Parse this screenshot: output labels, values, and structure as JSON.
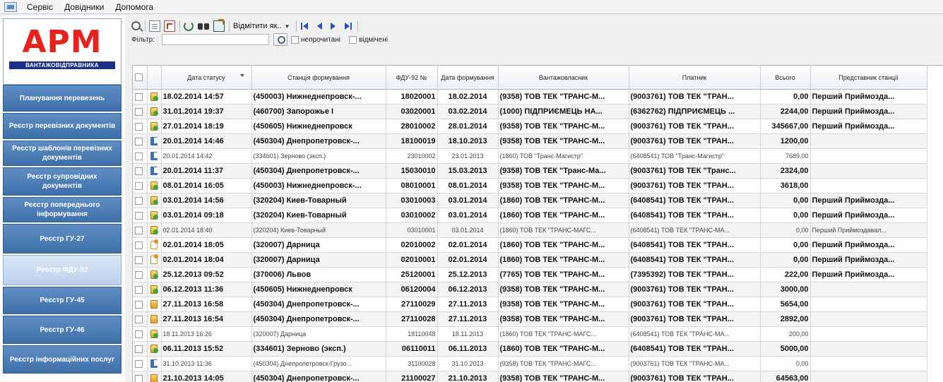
{
  "menu": {
    "items": [
      "Сервіс",
      "Довідники",
      "Допомога"
    ]
  },
  "logo": {
    "main": "АРМ",
    "sub": "ВАНТАЖОВІДПРАВНИКА"
  },
  "sidebar": {
    "items": [
      {
        "label": "Планування перевезень",
        "active": false
      },
      {
        "label": "Реєстр перевізних документів",
        "active": false
      },
      {
        "label": "Реєстр шаблонів перевізних документів",
        "active": false
      },
      {
        "label": "Реєстр супровідних документів",
        "active": false
      },
      {
        "label": "Реєстр попереднього інформування",
        "active": false
      },
      {
        "label": "Реєстр ГУ-27",
        "active": false
      },
      {
        "label": "Реєстр ФДУ-92",
        "active": true
      },
      {
        "label": "Реєстр ГУ-45",
        "active": false
      },
      {
        "label": "Реєстр ГУ-46",
        "active": false
      },
      {
        "label": "Реєстр інформаційних послуг",
        "active": false
      }
    ]
  },
  "toolbar": {
    "mark_label": "Відмітити як..",
    "icons": [
      "preview-icon",
      "document-icon",
      "pdf-icon",
      "refresh-icon",
      "binoculars-icon",
      "export-icon"
    ],
    "nav_icons": [
      "first-record-icon",
      "previous-record-icon",
      "next-record-icon",
      "last-record-icon"
    ]
  },
  "filter": {
    "label": "Фільтр:",
    "value": "",
    "checkbox_unread": "непрочитані",
    "checkbox_marked": "відмічені"
  },
  "grid": {
    "columns": [
      "Дата статусу",
      "Станція формування",
      "ФДУ-92 №",
      "Дата формування",
      "Вантажовласник",
      "Платник",
      "Всього",
      "Представник станції"
    ],
    "rows": [
      {
        "style": "bold",
        "icon": "green-status-icon",
        "date_status": "18.02.2014 14:57",
        "station": "(450003) Нижнеднепровск-...",
        "num": "18020001",
        "date_form": "18.02.2014",
        "owner": "(9358) ТОВ ТЕК \"ТРАНС-М...",
        "payer": "(9003761) ТОВ ТЕК \"ТРАН...",
        "total": "0,00",
        "rep": "Перший Приймоздa..."
      },
      {
        "style": "bold",
        "icon": "green-status-icon",
        "date_status": "31.01.2014 19:37",
        "station": "(460700) Запорожье I",
        "num": "03020001",
        "date_form": "03.02.2014",
        "owner": "(1000) ПІДПРИЄМЕЦЬ НА...",
        "payer": "(6362762) ПІДПРИЄМЕЦЬ ...",
        "total": "2244,00",
        "rep": "Перший Приймоздa..."
      },
      {
        "style": "bold",
        "icon": "green-status-icon",
        "date_status": "27.01.2014 18:19",
        "station": "(450605) Нижнеднепровск",
        "num": "28010002",
        "date_form": "28.01.2014",
        "owner": "(9358) ТОВ ТЕК \"ТРАНС-М...",
        "payer": "(9003761) ТОВ ТЕК \"ТРАН...",
        "total": "345667,00",
        "rep": "Перший Приймоздa..."
      },
      {
        "style": "bold",
        "icon": "blue-status-icon",
        "date_status": "20.01.2014 14:46",
        "station": "(450304) Днепропетровск-...",
        "num": "18100019",
        "date_form": "18.10.2013",
        "owner": "(9358) ТОВ ТЕК \"ТРАНС-М...",
        "payer": "(9003761) ТОВ ТЕК \"ТРАН...",
        "total": "1200,00",
        "rep": ""
      },
      {
        "style": "light",
        "icon": "blue-status-icon",
        "date_status": "20.01.2014 14:42",
        "station": "(334601) Зерново (эксп.)",
        "num": "23010002",
        "date_form": "23.01.2013",
        "owner": "(1860) ТОВ \"Транс-Магистр\"",
        "payer": "(6408541) ТОВ \"Транс-Магистр\"",
        "total": "7689,00",
        "rep": ""
      },
      {
        "style": "bold",
        "icon": "blue-status-icon",
        "date_status": "20.01.2014 11:37",
        "station": "(450304) Днепропетровск-...",
        "num": "15030010",
        "date_form": "15.03.2013",
        "owner": "(9358) ТОВ ТЕК \"Транс-Ма...",
        "payer": "(9003761) ТОВ ТЕК \"Транс...",
        "total": "2324,00",
        "rep": ""
      },
      {
        "style": "bold",
        "icon": "green-status-icon",
        "date_status": "08.01.2014 16:05",
        "station": "(450003) Нижнеднепровск-...",
        "num": "08010001",
        "date_form": "08.01.2014",
        "owner": "(9358) ТОВ ТЕК \"ТРАНС-М...",
        "payer": "(9003761) ТОВ ТЕК \"ТРАН...",
        "total": "3618,00",
        "rep": ""
      },
      {
        "style": "bold",
        "icon": "green-status-icon",
        "date_status": "03.01.2014 14:56",
        "station": "(320204) Киев-Товарный",
        "num": "03010003",
        "date_form": "03.01.2014",
        "owner": "(1860) ТОВ ТЕК \"ТРАНС-М...",
        "payer": "(6408541) ТОВ ТЕК \"ТРАН...",
        "total": "0,00",
        "rep": "Перший Приймоздa..."
      },
      {
        "style": "bold",
        "icon": "green-status-icon",
        "date_status": "03.01.2014 09:18",
        "station": "(320204) Киев-Товарный",
        "num": "03010002",
        "date_form": "03.01.2014",
        "owner": "(1860) ТОВ ТЕК \"ТРАНС-М...",
        "payer": "(6408541) ТОВ ТЕК \"ТРАН...",
        "total": "0,00",
        "rep": "Перший Приймоздa..."
      },
      {
        "style": "light",
        "icon": "green-status-icon",
        "date_status": "02.01.2014 18:40",
        "station": "(320204) Киев-Товарный",
        "num": "03010001",
        "date_form": "03.01.2014",
        "owner": "(1860) ТОВ ТЕК \"ТРАНС-МАГС...",
        "payer": "(6408541) ТОВ ТЕК \"ТРАНС-МА...",
        "total": "0,00",
        "rep": "Перший Приймоздавал..."
      },
      {
        "style": "bold",
        "icon": "doc-status-icon",
        "date_status": "02.01.2014 18:05",
        "station": "(320007) Дарница",
        "num": "02010002",
        "date_form": "02.01.2014",
        "owner": "(1860) ТОВ ТЕК \"ТРАНС-М...",
        "payer": "(6408541) ТОВ ТЕК \"ТРАН...",
        "total": "0,00",
        "rep": "Перший Приймоздa..."
      },
      {
        "style": "bold",
        "icon": "doc-status-icon",
        "date_status": "02.01.2014 18:04",
        "station": "(320007) Дарница",
        "num": "02010001",
        "date_form": "02.01.2014",
        "owner": "(1860) ТОВ ТЕК \"ТРАНС-М...",
        "payer": "(6408541) ТОВ ТЕК \"ТРАН...",
        "total": "0,00",
        "rep": "Перший Приймоздa..."
      },
      {
        "style": "bold",
        "icon": "green-status-icon",
        "date_status": "25.12.2013 09:52",
        "station": "(370006) Львов",
        "num": "25120001",
        "date_form": "25.12.2013",
        "owner": "(7765) ТОВ ТЕК \"ТРАНС-М...",
        "payer": "(7395392) ТОВ ТЕК \"ТРАН...",
        "total": "222,00",
        "rep": "Перший Приймоздa..."
      },
      {
        "style": "bold",
        "icon": "green-status-icon",
        "date_status": "06.12.2013 11:36",
        "station": "(450605) Нижнеднепровск",
        "num": "06120004",
        "date_form": "06.12.2013",
        "owner": "(9358) ТОВ ТЕК \"ТРАНС-М...",
        "payer": "(9003761) ТОВ ТЕК \"ТРАН...",
        "total": "3000,00",
        "rep": ""
      },
      {
        "style": "bold",
        "icon": "orange-status-icon",
        "date_status": "27.11.2013 16:58",
        "station": "(450304) Днепропетровск-...",
        "num": "27110029",
        "date_form": "27.11.2013",
        "owner": "(9358) ТОВ ТЕК \"ТРАНС-М...",
        "payer": "(9003761) ТОВ ТЕК \"ТРАН...",
        "total": "5654,00",
        "rep": ""
      },
      {
        "style": "bold",
        "icon": "orange-status-icon",
        "date_status": "27.11.2013 16:54",
        "station": "(450304) Днепропетровск-...",
        "num": "27110028",
        "date_form": "27.11.2013",
        "owner": "(9358) ТОВ ТЕК \"ТРАНС-М...",
        "payer": "(9003761) ТОВ ТЕК \"ТРАН...",
        "total": "2892,00",
        "rep": ""
      },
      {
        "style": "light",
        "icon": "green-status-icon",
        "date_status": "18.11.2013 16:26",
        "station": "(320007) Дарница",
        "num": "18110048",
        "date_form": "18.11.2013",
        "owner": "(1860) ТОВ ТЕК \"ТРАНС-МАГС...",
        "payer": "(6408541) ТОВ ТЕК \"ТРАНС-МА...",
        "total": "200,00",
        "rep": ""
      },
      {
        "style": "bold",
        "icon": "green-status-icon",
        "date_status": "06.11.2013 15:52",
        "station": "(334601) Зерново (эксп.)",
        "num": "06110011",
        "date_form": "06.11.2013",
        "owner": "(1860) ТОВ ТЕК \"ТРАНС-М...",
        "payer": "(6408541) ТОВ ТЕК \"ТРАН...",
        "total": "5000,00",
        "rep": ""
      },
      {
        "style": "light",
        "icon": "blue-status-icon",
        "date_status": "31.10.2013 11:36",
        "station": "(450304) Днепропетровск-Грузо...",
        "num": "31100028",
        "date_form": "31.10.2013",
        "owner": "(9358) ТОВ ТЕК \"ТРАНС-МАГС...",
        "payer": "(9003761) ТОВ ТЕК \"ТРАНС-МА...",
        "total": "0,00",
        "rep": ""
      },
      {
        "style": "bold",
        "icon": "orange-status-icon",
        "date_status": "21.10.2013 14:05",
        "station": "(450304) Днепропетровск-...",
        "num": "21100027",
        "date_form": "21.10.2013",
        "owner": "(9358) ТОВ ТЕК \"ТРАНС-М...",
        "payer": "(9003761) ТОВ ТЕК \"ТРАН...",
        "total": "64563,00",
        "rep": ""
      }
    ]
  },
  "colors": {
    "nav_button": "#3e6fa8",
    "nav_button_active": "#bcd1ea",
    "logo_red": "#e8231f",
    "logo_blue": "#1b2f8a"
  }
}
